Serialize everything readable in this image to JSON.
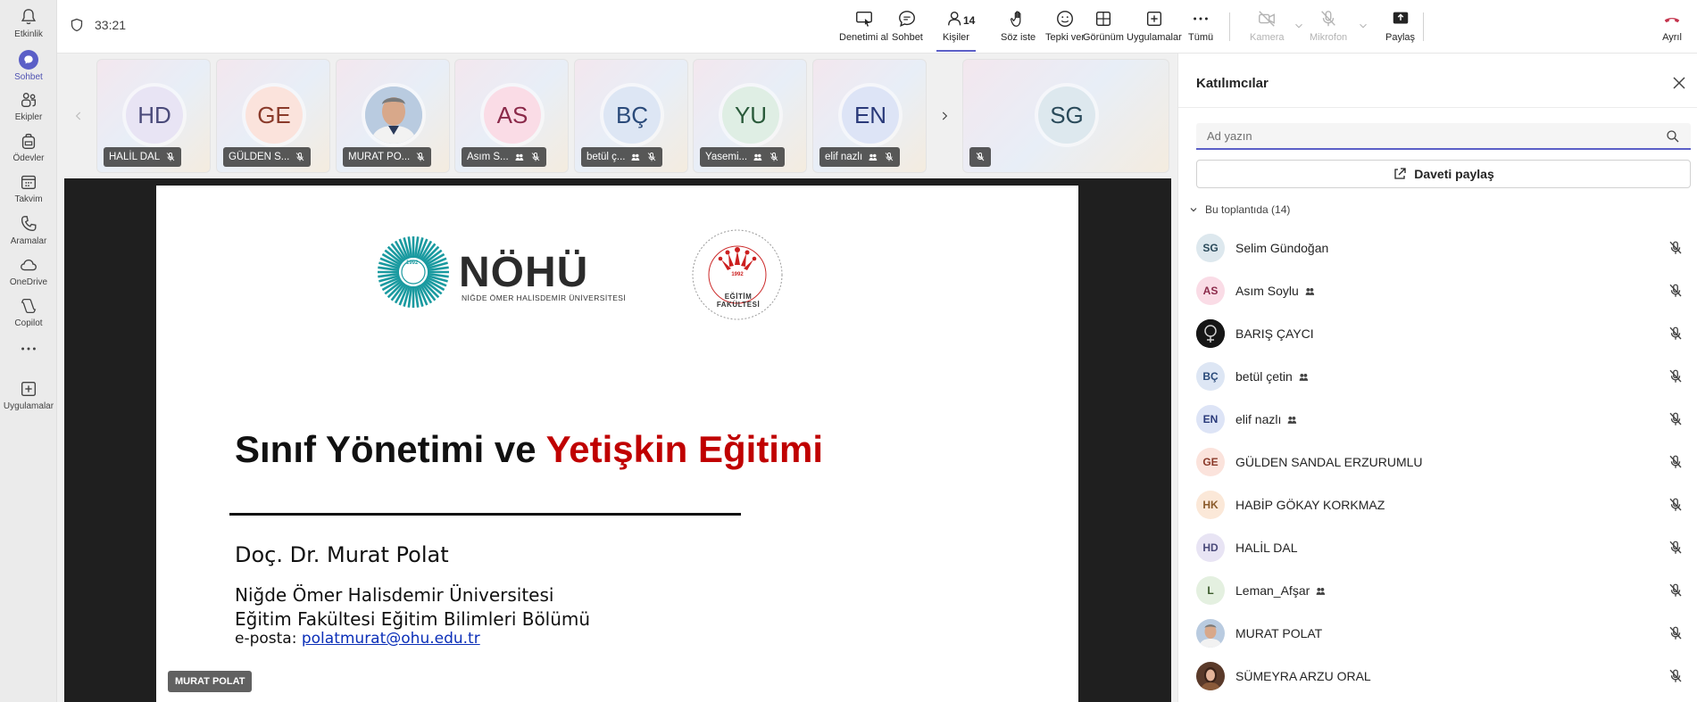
{
  "rail": [
    {
      "label": "Etkinlik",
      "icon": "bell-icon"
    },
    {
      "label": "Sohbet",
      "icon": "chat-icon",
      "active": true
    },
    {
      "label": "Ekipler",
      "icon": "teams-icon"
    },
    {
      "label": "Ödevler",
      "icon": "backpack-icon"
    },
    {
      "label": "Takvim",
      "icon": "calendar-icon"
    },
    {
      "label": "Aramalar",
      "icon": "phone-icon"
    },
    {
      "label": "OneDrive",
      "icon": "cloud-icon"
    },
    {
      "label": "Copilot",
      "icon": "copilot-icon"
    },
    {
      "label": "",
      "icon": "more-icon"
    },
    {
      "label": "Uygulamalar",
      "icon": "add-app-icon"
    }
  ],
  "topbar": {
    "timer": "33:21",
    "buttons": {
      "control": "Denetimi al",
      "chat": "Sohbet",
      "people": "Kişiler",
      "people_count": "14",
      "raise": "Söz iste",
      "react": "Tepki ver",
      "view": "Görünüm",
      "apps": "Uygulamalar",
      "more": "Tümü",
      "camera": "Kamera",
      "mic": "Mikrofon",
      "share": "Paylaş",
      "leave": "Ayrıl"
    }
  },
  "gallery": [
    {
      "initials": "HD",
      "label": "HALİL DAL",
      "bg": "#e8e4f4",
      "fg": "#4a4a7a"
    },
    {
      "initials": "GE",
      "label": "GÜLDEN S...",
      "bg": "#fbe3dc",
      "fg": "#8a3a2a"
    },
    {
      "initials": "MP",
      "label": "MURAT PO...",
      "bg": "#c8d6e4",
      "fg": "#2c3e50",
      "photo": true
    },
    {
      "initials": "AS",
      "label": "Asım S...",
      "bg": "#fadce6",
      "fg": "#8b2a4a",
      "hand": true
    },
    {
      "initials": "BÇ",
      "label": "betül ç...",
      "bg": "#dde6f4",
      "fg": "#2a4a7a",
      "hand": true
    },
    {
      "initials": "YU",
      "label": "Yasemi...",
      "bg": "#dfeee4",
      "fg": "#2a5a3a",
      "hand": true
    },
    {
      "initials": "EN",
      "label": "elif nazlı",
      "bg": "#dde4f6",
      "fg": "#2a3a7a",
      "hand": true
    }
  ],
  "gallery_extra": {
    "initials": "SG",
    "bg": "#dde8ee",
    "fg": "#2a4a5a"
  },
  "slide": {
    "logo_text": "NÖHÜ",
    "logo_sub": "NİĞDE ÖMER HALİSDEMİR ÜNİVERSİTESİ",
    "logo_year": "1992",
    "seal_text": "EĞİTİM FAKÜLTESİ",
    "title_black": "Sınıf Yönetimi ve ",
    "title_red": "Yetişkin Eğitimi",
    "author": "Doç. Dr. Murat Polat",
    "univ_line1": "Niğde Ömer Halisdemir Üniversitesi",
    "univ_line2": "Eğitim Fakültesi Eğitim Bilimleri Bölümü",
    "mail_label": "e-posta: ",
    "mail": "polatmurat@ohu.edu.tr"
  },
  "presenter_chip": "MURAT POLAT",
  "panel": {
    "title": "Katılımcılar",
    "search_placeholder": "Ad yazın",
    "share_invite": "Daveti paylaş",
    "section": "Bu toplantıda (14)",
    "participants": [
      {
        "initials": "SG",
        "name": "Selim Gündoğan",
        "bg": "#dde8ee",
        "fg": "#2a4a5a"
      },
      {
        "initials": "AS",
        "name": "Asım Soylu",
        "bg": "#fadce6",
        "fg": "#8b2a4a",
        "hand": true
      },
      {
        "initials": "",
        "name": "BARIŞ ÇAYCI",
        "bg": "#1a1a1a",
        "fg": "#ffffff",
        "photo": "dark"
      },
      {
        "initials": "BÇ",
        "name": "betül çetin",
        "bg": "#dde6f4",
        "fg": "#2a4a7a",
        "hand": true
      },
      {
        "initials": "EN",
        "name": "elif nazlı",
        "bg": "#dde4f6",
        "fg": "#2a3a7a",
        "hand": true
      },
      {
        "initials": "GE",
        "name": "GÜLDEN SANDAL ERZURUMLU",
        "bg": "#fbe3dc",
        "fg": "#8a3a2a"
      },
      {
        "initials": "HK",
        "name": "HABİP GÖKAY KORKMAZ",
        "bg": "#fbe8d8",
        "fg": "#8a5a2a"
      },
      {
        "initials": "HD",
        "name": "HALİL DAL",
        "bg": "#e8e4f4",
        "fg": "#4a4a7a"
      },
      {
        "initials": "L",
        "name": "Leman_Afşar",
        "bg": "#e4f0e0",
        "fg": "#3a5a2a",
        "hand": true
      },
      {
        "initials": "",
        "name": "MURAT POLAT",
        "bg": "#c8d6e4",
        "fg": "#2c3e50",
        "photo": "face"
      },
      {
        "initials": "",
        "name": "SÜMEYRA ARZU ORAL",
        "bg": "#8a5a3a",
        "fg": "#ffffff",
        "photo": "face2"
      }
    ]
  }
}
